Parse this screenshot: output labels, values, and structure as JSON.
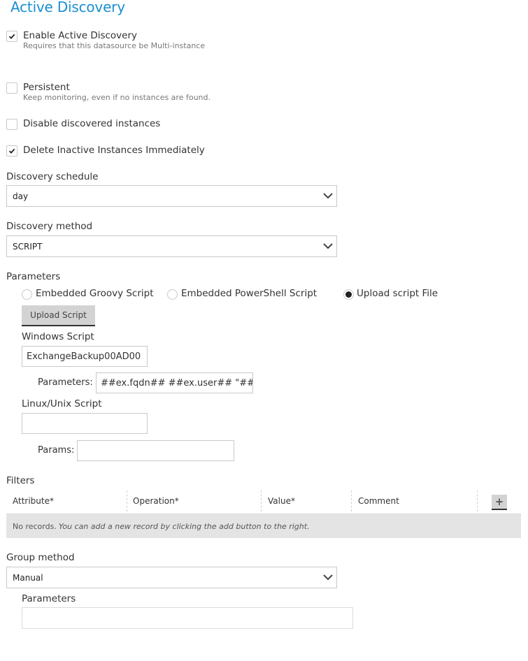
{
  "page": {
    "title": "Active Discovery"
  },
  "options": {
    "enable_active_discovery": {
      "label": "Enable Active Discovery",
      "hint": "Requires that this datasource be Multi-instance",
      "checked": true
    },
    "persistent": {
      "label": "Persistent",
      "hint": "Keep monitoring, even if no instances are found.",
      "checked": false
    },
    "disable_discovered": {
      "label": "Disable discovered instances",
      "checked": false
    },
    "delete_inactive": {
      "label": "Delete Inactive Instances Immediately",
      "checked": true
    }
  },
  "discovery_schedule": {
    "label": "Discovery schedule",
    "value": "day"
  },
  "discovery_method": {
    "label": "Discovery method",
    "value": "SCRIPT"
  },
  "parameters": {
    "label": "Parameters",
    "script_types": [
      {
        "label": "Embedded Groovy Script",
        "selected": false
      },
      {
        "label": "Embedded PowerShell Script",
        "selected": false
      },
      {
        "label": "Upload script File",
        "selected": true
      }
    ],
    "upload_button": "Upload Script",
    "windows_script": {
      "label": "Windows Script",
      "value": "ExchangeBackup00AD00",
      "params_label": "Parameters:",
      "params_value": "##ex.fqdn## ##ex.user## \"##"
    },
    "linux_script": {
      "label": "Linux/Unix Script",
      "value": "",
      "params_label": "Params:",
      "params_value": ""
    }
  },
  "filters": {
    "label": "Filters",
    "columns": [
      "Attribute*",
      "Operation*",
      "Value*",
      "Comment"
    ],
    "add_button": "+",
    "empty_prefix": "No records.",
    "empty_message": "You can add a new record by clicking the add button to the right."
  },
  "group_method": {
    "label": "Group method",
    "value": "Manual",
    "params_label": "Parameters",
    "params_value": ""
  }
}
